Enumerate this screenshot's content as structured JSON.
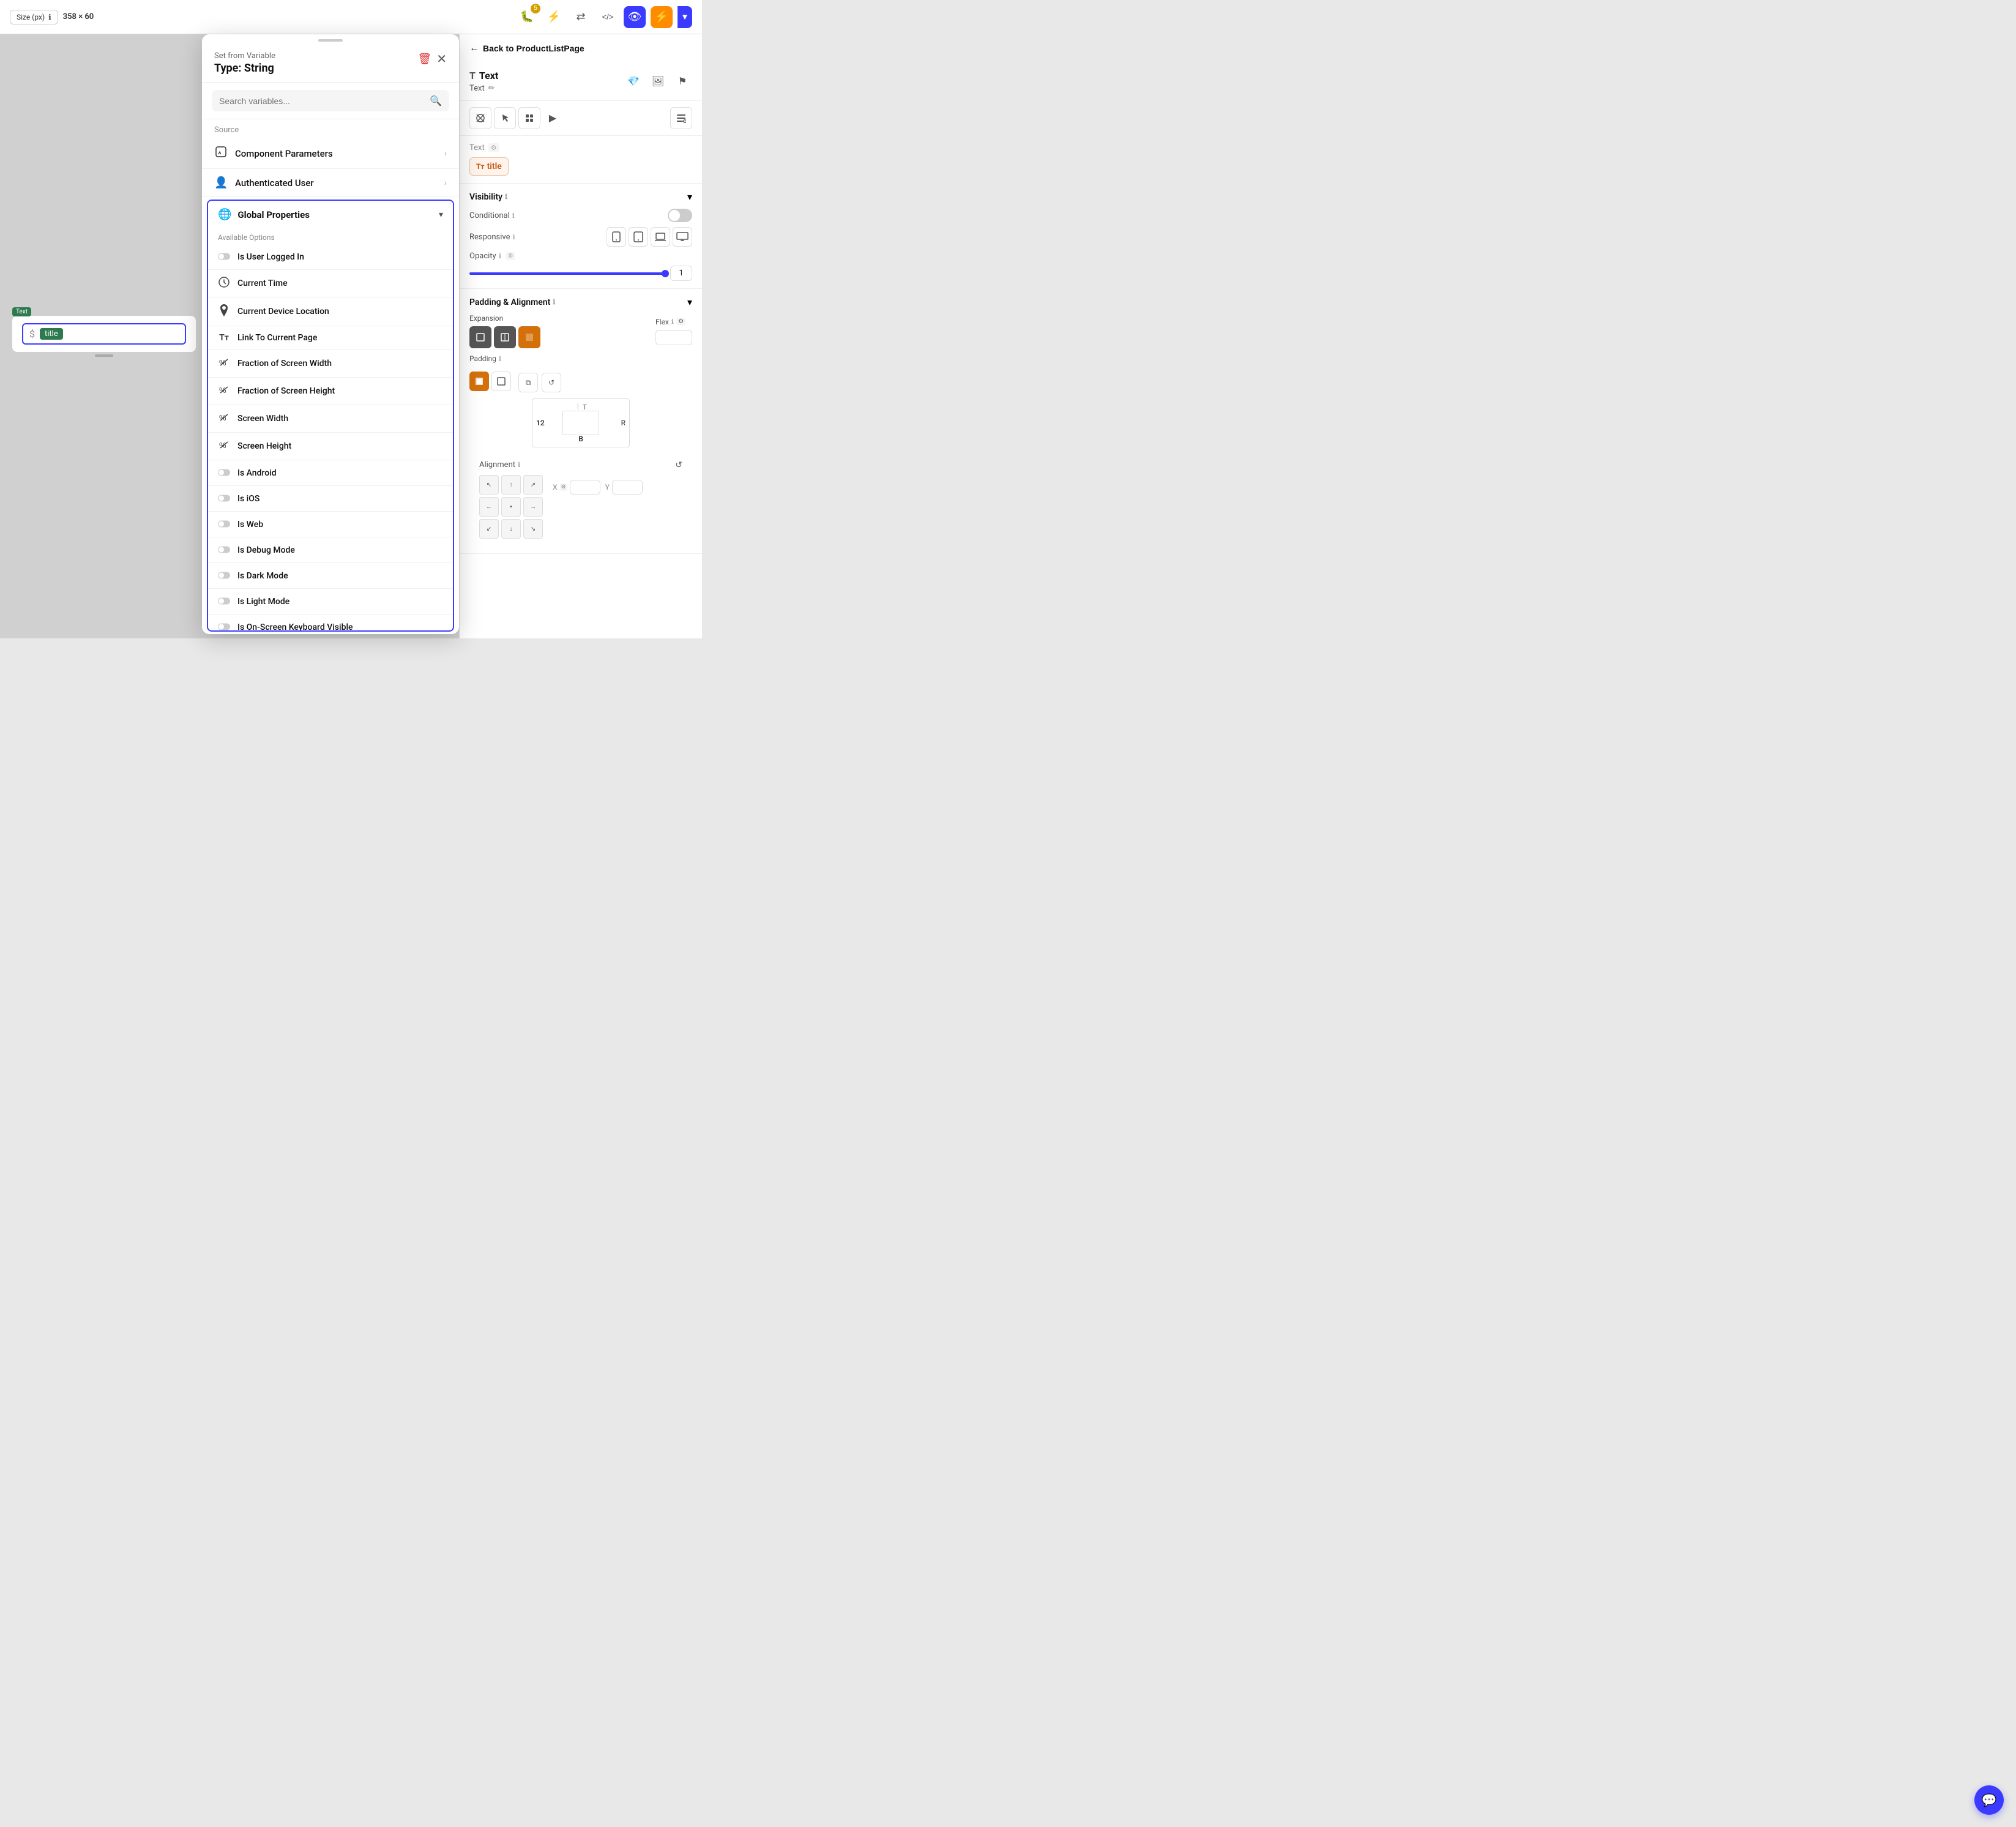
{
  "topBar": {
    "size_label": "Size (px)",
    "dimensions": "358 × 60",
    "info_icon": "ℹ",
    "toolbar_icons": [
      {
        "name": "lightning-icon",
        "symbol": "⚡",
        "active": false
      },
      {
        "name": "cursor-icon",
        "symbol": "↗",
        "active": false
      },
      {
        "name": "share-icon",
        "symbol": "⇄",
        "active": false
      },
      {
        "name": "code-icon",
        "symbol": "</>",
        "active": false
      },
      {
        "name": "eye-icon",
        "symbol": "👁",
        "active": true
      },
      {
        "name": "flash-icon",
        "symbol": "⚡",
        "active": false,
        "orange": true
      }
    ],
    "notification_count": "5",
    "bug_icon": "🐛",
    "dropdown_arrow": "▼"
  },
  "modal": {
    "title_small": "Set from Variable",
    "title_large": "Type: String",
    "delete_label": "🗑",
    "close_label": "✕",
    "search_placeholder": "Search variables...",
    "search_icon": "🔍",
    "source_label": "Source",
    "source_items": [
      {
        "name": "component-parameters",
        "icon": "⬛",
        "label": "Component Parameters",
        "has_arrow": true
      },
      {
        "name": "authenticated-user",
        "icon": "👤",
        "label": "Authenticated User",
        "has_arrow": true
      }
    ],
    "global_section": {
      "icon": "🌐",
      "title": "Global Properties",
      "chevron": "▼",
      "options_label": "Available Options",
      "options": [
        {
          "name": "is-user-logged-in",
          "icon": "toggle",
          "label": "Is User Logged In"
        },
        {
          "name": "current-time",
          "icon": "clock",
          "label": "Current Time"
        },
        {
          "name": "current-device-location",
          "icon": "pin",
          "label": "Current Device Location"
        },
        {
          "name": "link-to-current-page",
          "icon": "text",
          "label": "Link To Current Page"
        },
        {
          "name": "fraction-of-screen-width",
          "icon": "percent",
          "label": "Fraction of Screen Width"
        },
        {
          "name": "fraction-of-screen-height",
          "icon": "percent",
          "label": "Fraction of Screen Height"
        },
        {
          "name": "screen-width",
          "icon": "percent",
          "label": "Screen Width"
        },
        {
          "name": "screen-height",
          "icon": "percent",
          "label": "Screen Height"
        },
        {
          "name": "is-android",
          "icon": "toggle",
          "label": "Is Android"
        },
        {
          "name": "is-ios",
          "icon": "toggle",
          "label": "Is iOS"
        },
        {
          "name": "is-web",
          "icon": "toggle",
          "label": "Is Web"
        },
        {
          "name": "is-debug-mode",
          "icon": "toggle",
          "label": "Is Debug Mode"
        },
        {
          "name": "is-dark-mode",
          "icon": "toggle",
          "label": "Is Dark Mode"
        },
        {
          "name": "is-light-mode",
          "icon": "toggle",
          "label": "Is Light Mode"
        },
        {
          "name": "is-on-screen-keyboard-visible",
          "icon": "toggle",
          "label": "Is On-Screen Keyboard Visible"
        }
      ]
    }
  },
  "rightPanel": {
    "back_label": "Back to ProductListPage",
    "back_arrow": "←",
    "component_icon": "T",
    "component_name": "Text",
    "component_sub": "Text",
    "edit_icon": "✏",
    "header_icons": [
      "💎",
      "🖼",
      "⚑"
    ],
    "toolbar_icons": [
      "✕",
      "↗",
      "⊞",
      "▶",
      "📋"
    ],
    "text_section": {
      "label": "Text",
      "label_icon": "⚙",
      "var_icon": "T",
      "var_name": "title"
    },
    "visibility": {
      "title": "Visibility",
      "info": "ℹ",
      "chevron": "▼",
      "conditional_label": "Conditional",
      "conditional_info": "ℹ",
      "responsive_label": "Responsive",
      "responsive_info": "ℹ",
      "responsive_icons": [
        "📱",
        "□",
        "□",
        "🖥"
      ],
      "opacity_label": "Opacity",
      "opacity_info": "ℹ",
      "opacity_icon": "⚙",
      "opacity_value": "1"
    },
    "padding_alignment": {
      "title": "Padding & Alignment",
      "info": "ℹ",
      "chevron": "▼",
      "expansion_label": "Expansion",
      "flex_label": "Flex",
      "flex_info": "ℹ",
      "flex_icon": "⚙",
      "padding_label": "Padding",
      "padding_info": "ℹ",
      "padding_top": "T",
      "padding_bottom": "B",
      "padding_left": "12",
      "padding_right": "R",
      "alignment_label": "Alignment",
      "alignment_info": "ℹ",
      "reset_icon": "↺",
      "x_label": "X",
      "x_icon": "⚙",
      "y_label": "Y"
    }
  },
  "canvasElement": {
    "text_badge": "Text",
    "dollar_sign": "$",
    "title_chip": "title",
    "handle": ""
  },
  "chatFab": {
    "icon": "💬"
  },
  "colors": {
    "accent": "#3b3bff",
    "orange": "#d4700a",
    "green_badge": "#2d7a4f"
  }
}
